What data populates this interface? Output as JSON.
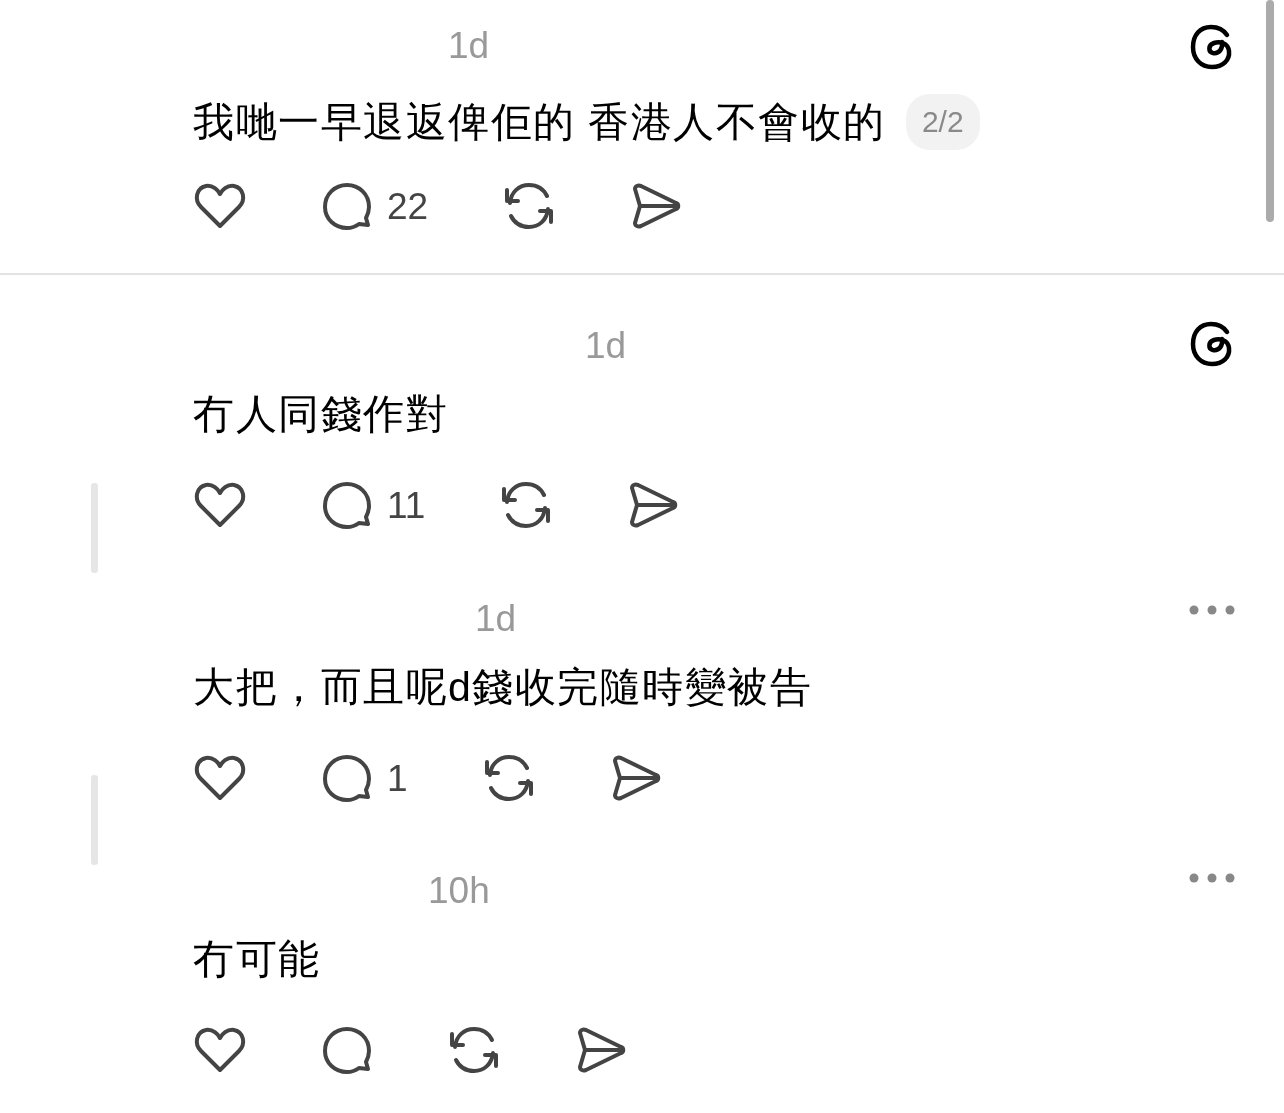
{
  "posts": [
    {
      "time": "1d",
      "text": "我哋一早退返俾佢的 香港人不會收的",
      "page_badge": "2/2",
      "comments": "22",
      "corner_icon": {
        "kind": "threads"
      },
      "thread_line": false,
      "divider_after": true
    },
    {
      "time": "1d",
      "text": "冇人同錢作對",
      "comments": "11",
      "corner_icon": {
        "kind": "threads"
      },
      "thread_line": true,
      "divider_after": false
    },
    {
      "time": "1d",
      "text": "大把，而且呢d錢收完隨時變被告",
      "comments": "1",
      "corner_icon": {
        "kind": "more"
      },
      "thread_line": true,
      "divider_after": false
    },
    {
      "time": "10h",
      "text": "冇可能",
      "corner_icon": {
        "kind": "more"
      },
      "thread_line": false,
      "divider_after": false
    }
  ]
}
